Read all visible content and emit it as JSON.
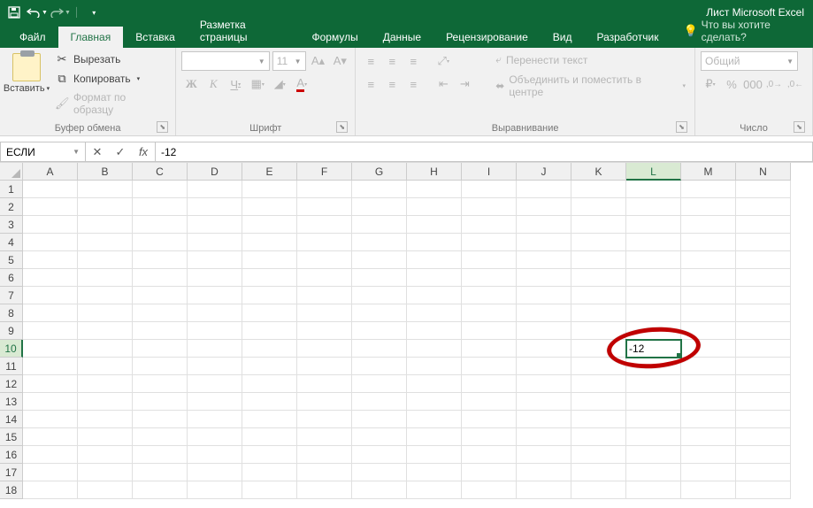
{
  "app_title": "Лист Microsoft Excel",
  "qat": {
    "save": "save",
    "undo": "undo",
    "redo": "redo"
  },
  "tabs": {
    "file": "Файл",
    "home": "Главная",
    "insert": "Вставка",
    "layout": "Разметка страницы",
    "formulas": "Формулы",
    "data": "Данные",
    "review": "Рецензирование",
    "view": "Вид",
    "developer": "Разработчик",
    "tellme": "Что вы хотите сделать?"
  },
  "ribbon": {
    "clipboard": {
      "paste": "Вставить",
      "cut": "Вырезать",
      "copy": "Копировать",
      "format_painter": "Формат по образцу",
      "label": "Буфер обмена"
    },
    "font": {
      "name": "",
      "size": "11",
      "label": "Шрифт",
      "bold": "Ж",
      "italic": "К",
      "underline": "Ч"
    },
    "alignment": {
      "wrap": "Перенести текст",
      "merge": "Объединить и поместить в центре",
      "label": "Выравнивание"
    },
    "number": {
      "format": "Общий",
      "label": "Число"
    }
  },
  "namebox": "ЕСЛИ",
  "formula_bar": "-12",
  "columns": [
    "A",
    "B",
    "C",
    "D",
    "E",
    "F",
    "G",
    "H",
    "I",
    "J",
    "K",
    "L",
    "M",
    "N"
  ],
  "row_count": 18,
  "active": {
    "col": "L",
    "row": 10,
    "value": "-12"
  },
  "colors": {
    "brand": "#0e6837",
    "accent": "#217346",
    "annot": "#c00000"
  }
}
